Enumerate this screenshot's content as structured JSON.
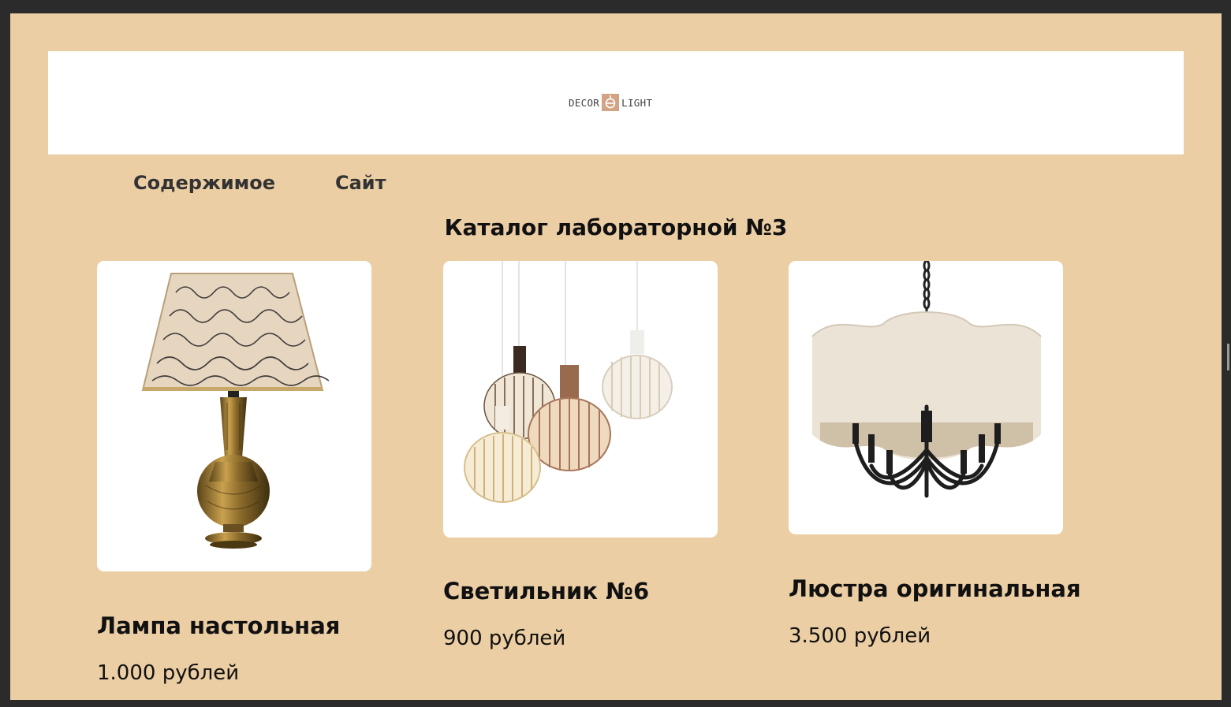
{
  "brand": {
    "left": "DECOR",
    "right": "LIGHT",
    "accent_color": "#d3a386",
    "icon": "lamp-icon"
  },
  "nav": {
    "items": [
      {
        "label": "Содержимое"
      },
      {
        "label": "Сайт"
      }
    ]
  },
  "page": {
    "title": "Каталог лабораторной №3",
    "background": "#eccea4"
  },
  "products": [
    {
      "name": "Лампа настольная",
      "price": "1.000 рублей",
      "image": "table-lamp-image"
    },
    {
      "name": "Светильник №6",
      "price": "900 рублей",
      "image": "pendant-lights-image"
    },
    {
      "name": "Люстра оригинальная",
      "price": "3.500 рублей",
      "image": "chandelier-image"
    }
  ]
}
